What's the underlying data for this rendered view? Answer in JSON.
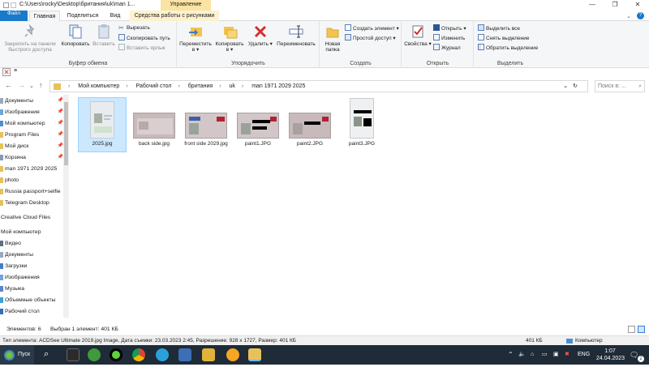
{
  "window": {
    "title_path": "C:\\Users\\rocky\\Desktop\\британия\\uk\\man 1...",
    "context_header": "Управление"
  },
  "tabs": [
    {
      "label": "Файл"
    },
    {
      "label": "Главная"
    },
    {
      "label": "Поделиться"
    },
    {
      "label": "Вид"
    },
    {
      "label": "Средства работы с рисунками"
    }
  ],
  "ribbon": {
    "clipboard": {
      "pin_label": "Закрепить на панели быстрого доступа",
      "copy_label": "Копировать",
      "paste_label": "Вставить",
      "cut_label": "Вырезать",
      "copy_path_label": "Скопировать путь",
      "paste_shortcut_label": "Вставить ярлык",
      "group_label": "Буфер обмена"
    },
    "organize": {
      "move_label": "Переместить в ▾",
      "copyto_label": "Копировать в ▾",
      "delete_label": "Удалить ▾",
      "rename_label": "Переименовать",
      "group_label": "Упорядочить"
    },
    "create": {
      "new_folder_label": "Новая папка",
      "new_item_label": "Создать элемент ▾",
      "easy_access_label": "Простой доступ ▾",
      "group_label": "Создать"
    },
    "open": {
      "properties_label": "Свойства ▾",
      "open_label": "Открыть ▾",
      "edit_label": "Изменить",
      "history_label": "Журнал",
      "group_label": "Открыть"
    },
    "select": {
      "select_all_label": "Выделить все",
      "select_none_label": "Снять выделение",
      "invert_label": "Обратить выделение",
      "group_label": "Выделить"
    }
  },
  "address": {
    "crumbs": [
      "Мой компьютер",
      "Рабочий стол",
      "британия",
      "uk",
      "man 1971 2029 2025"
    ],
    "search_placeholder": "Поиск в: ..."
  },
  "sidebar": {
    "items": [
      {
        "label": "Документы",
        "pinned": true
      },
      {
        "label": "Изображения",
        "pinned": true
      },
      {
        "label": "Мой компьютер",
        "pinned": true
      },
      {
        "label": "Program Files",
        "pinned": true
      },
      {
        "label": "Мой диск",
        "pinned": true
      },
      {
        "label": "Корзина",
        "pinned": true
      },
      {
        "label": "man 1971 2029 2025",
        "pinned": false
      },
      {
        "label": "photo",
        "pinned": false
      },
      {
        "label": "Russia passport+selfie",
        "pinned": false
      },
      {
        "label": "Telegram Desktop",
        "pinned": false
      },
      {
        "label": "Creative Cloud Files",
        "pinned": false
      },
      {
        "label": "Мой компьютер",
        "pinned": false
      },
      {
        "label": "Видео",
        "pinned": false
      },
      {
        "label": "Документы",
        "pinned": false
      },
      {
        "label": "Загрузки",
        "pinned": false
      },
      {
        "label": "Изображения",
        "pinned": false
      },
      {
        "label": "Музыка",
        "pinned": false
      },
      {
        "label": "Объемные объекты",
        "pinned": false
      },
      {
        "label": "Рабочий стол",
        "pinned": false
      }
    ]
  },
  "files": [
    {
      "name": "2025.jpg",
      "selected": true
    },
    {
      "name": "back side.jpg",
      "selected": false
    },
    {
      "name": "front side 2029.jpg",
      "selected": false
    },
    {
      "name": "paint1.JPG",
      "selected": false
    },
    {
      "name": "paint2.JPG",
      "selected": false
    },
    {
      "name": "paint3.JPG",
      "selected": false
    }
  ],
  "status": {
    "count": "Элементов: 6",
    "selection": "Выбран 1 элемент: 401 КБ",
    "details": "Тип элемента: ACDSee Ultimate 2019.jpg Image, Дата съемки: 23.03.2023 2:45, Разрешение: 928 x 1727, Размер: 401 КБ",
    "size": "401 КБ",
    "location": "Компьютер"
  },
  "taskbar": {
    "start_label": "Пуск",
    "lang": "ENG",
    "time": "1:07",
    "date": "24.04.2023",
    "notifications": "2"
  }
}
